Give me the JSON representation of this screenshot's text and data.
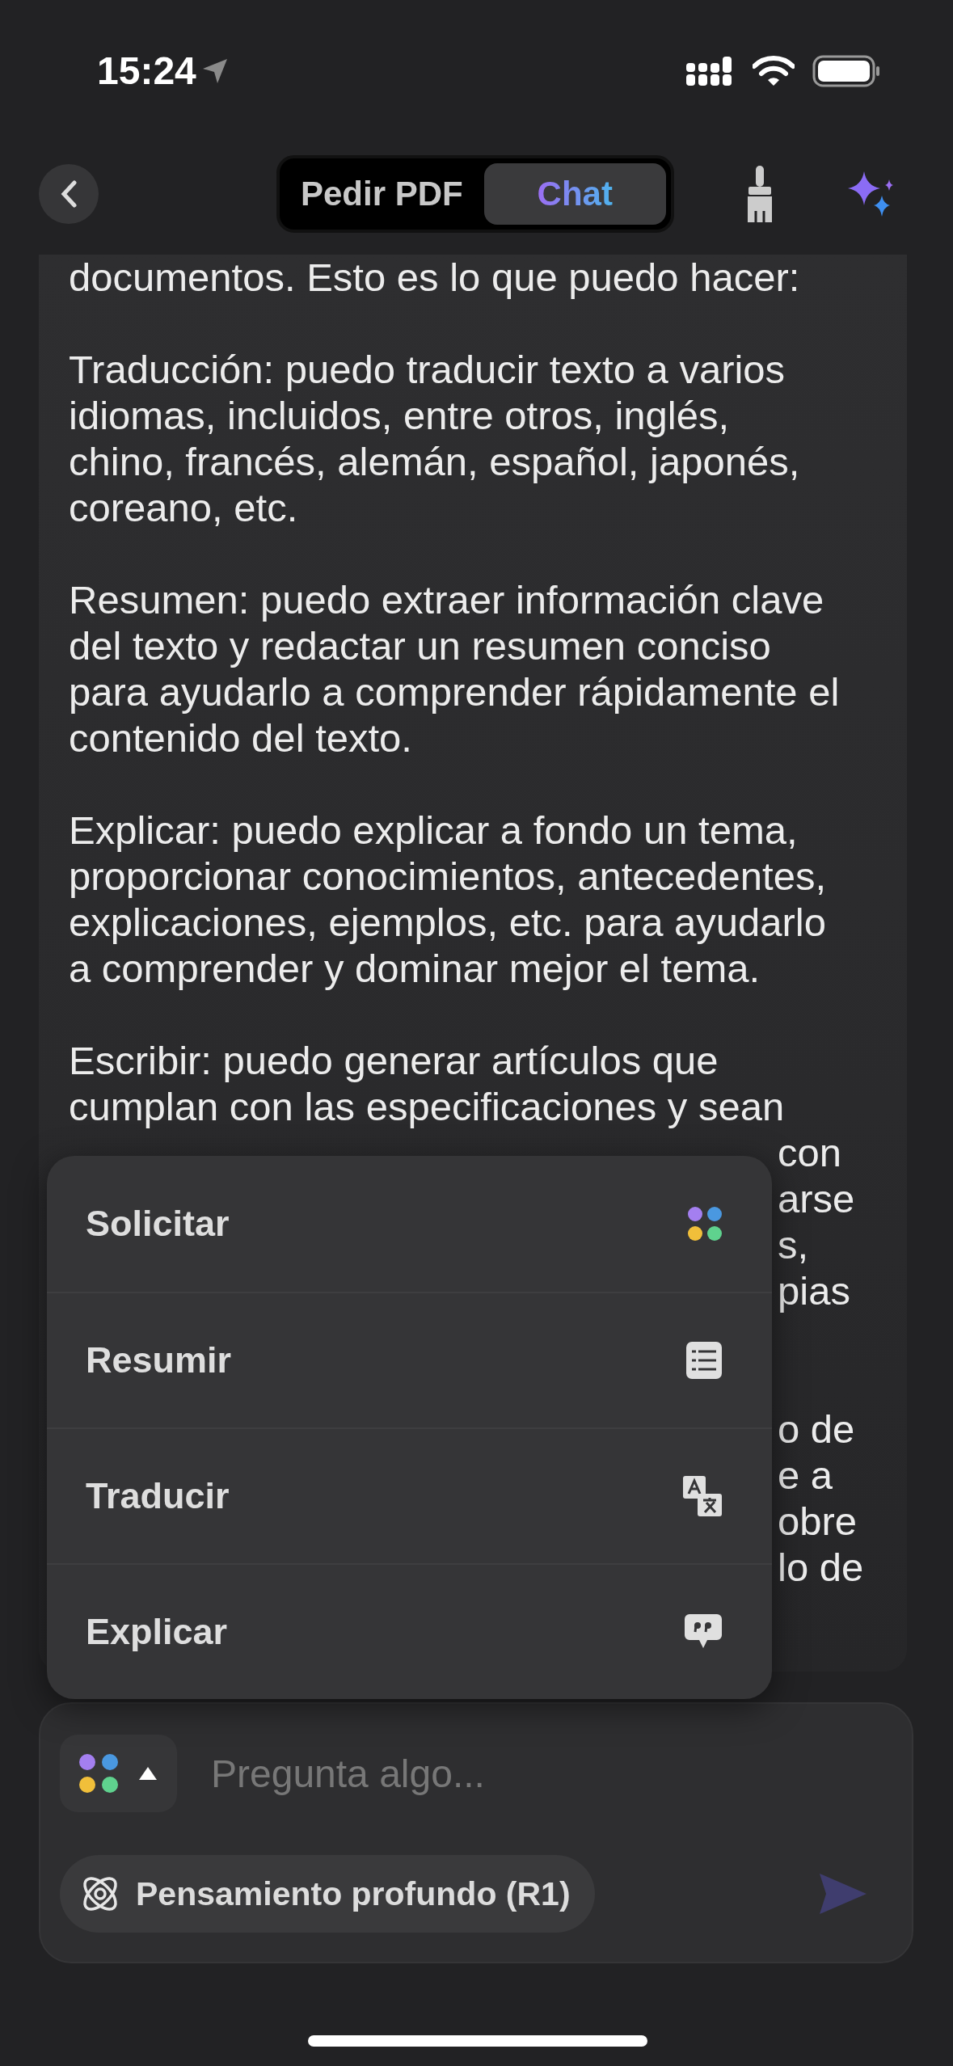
{
  "status_bar": {
    "time": "15:24"
  },
  "header": {
    "tabs": [
      {
        "label": "Pedir PDF",
        "selected": false
      },
      {
        "label": "Chat",
        "selected": true
      }
    ]
  },
  "message": {
    "paragraphs": [
      {
        "lines": [
          "documentos. Esto es lo que puedo hacer:"
        ]
      },
      {
        "lines": [
          "Traducción: puedo traducir texto a varios",
          "idiomas, incluidos, entre otros, inglés,",
          "chino, francés, alemán, español, japonés,",
          "coreano, etc."
        ]
      },
      {
        "lines": [
          "Resumen: puedo extraer información clave",
          "del texto y redactar un resumen conciso",
          "para ayudarlo a comprender rápidamente el",
          "contenido del texto."
        ]
      },
      {
        "lines": [
          "Explicar: puedo explicar a fondo un tema,",
          "proporcionar conocimientos, antecedentes,",
          "explicaciones, ejemplos, etc. para ayudarlo",
          "a comprender y dominar mejor el tema."
        ]
      },
      {
        "lines": [
          "Escribir: puedo generar artículos que",
          "cumplan con las especificaciones y sean"
        ]
      }
    ],
    "fragment_groups": [
      [
        "con",
        "arse",
        "s,",
        "pias"
      ],
      [
        "o de",
        "e a",
        "obre",
        "lo de"
      ]
    ]
  },
  "menu": {
    "items": [
      {
        "label": "Solicitar",
        "kind": "prompt"
      },
      {
        "label": "Resumir",
        "kind": "summary"
      },
      {
        "label": "Traducir",
        "kind": "translate"
      },
      {
        "label": "Explicar",
        "kind": "explain"
      }
    ]
  },
  "composer": {
    "placeholder": "Pregunta algo...",
    "chip": "Pensamiento profundo (R1)"
  }
}
